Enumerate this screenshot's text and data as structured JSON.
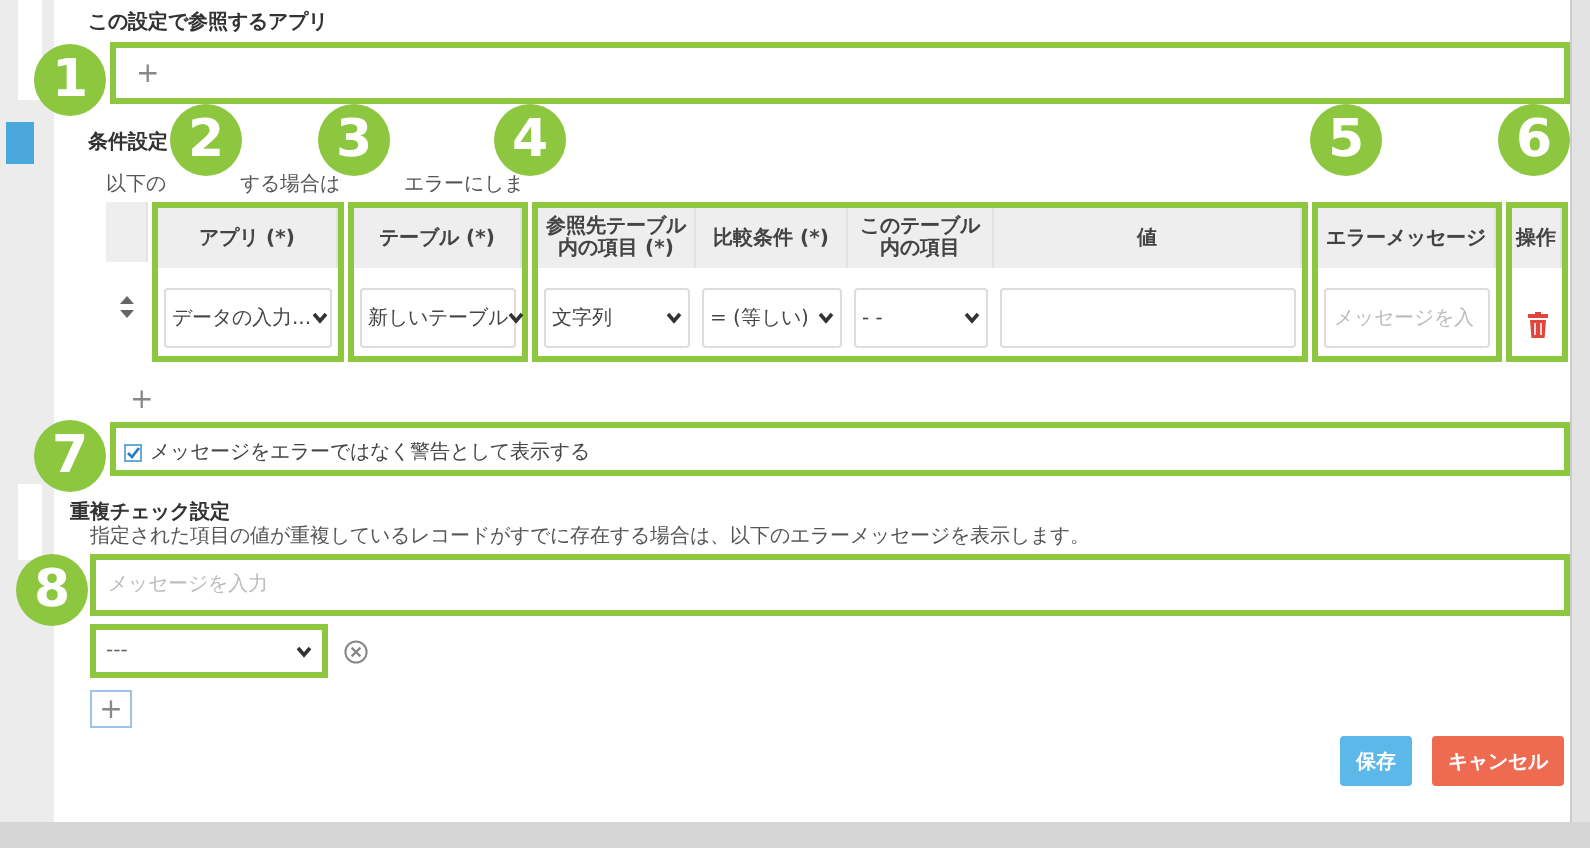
{
  "reference_apps": {
    "title": "この設定で参照するアプリ",
    "add": "+"
  },
  "conditions": {
    "title": "条件設定",
    "note_fragments": [
      "以下の",
      "する場合は",
      "エラーにしま"
    ],
    "columns": [
      {
        "label": "アプリ (*)"
      },
      {
        "label": "テーブル (*)"
      },
      {
        "label": "参照先テーブル内の項目 (*)"
      },
      {
        "label": "比較条件 (*)"
      },
      {
        "label": "このテーブル内の項目"
      },
      {
        "label": "値"
      },
      {
        "label": "エラーメッセージ"
      },
      {
        "label": "操作"
      }
    ],
    "rows": [
      {
        "cells": [
          {
            "kind": "select",
            "value": "データの入力..."
          },
          {
            "kind": "select",
            "value": "新しいテーブル"
          },
          {
            "kind": "select",
            "value": "文字列"
          },
          {
            "kind": "select",
            "value": "= (等しい)"
          },
          {
            "kind": "select",
            "value": "- -"
          },
          {
            "kind": "input"
          },
          {
            "kind": "input",
            "placeholder": "メッセージを入"
          },
          {
            "kind": "delete"
          }
        ]
      }
    ],
    "add": "+"
  },
  "warning_option": {
    "label": "メッセージをエラーではなく警告として表示する",
    "checked": true
  },
  "duplicate_check": {
    "title": "重複チェック設定",
    "note": "指定された項目の値が重複しているレコードがすでに存在する場合は、以下のエラーメッセージを表示します。",
    "message": {
      "placeholder": "メッセージを入力"
    },
    "fields": [
      {
        "value": "---"
      }
    ],
    "add": "+"
  },
  "buttons": [
    {
      "label": "保存",
      "kind": "primary"
    },
    {
      "label": "キャンセル",
      "kind": "danger"
    }
  ],
  "annotations": [
    {
      "number": "1"
    },
    {
      "number": "2"
    },
    {
      "number": "3"
    },
    {
      "number": "4"
    },
    {
      "number": "5"
    },
    {
      "number": "6"
    },
    {
      "number": "7"
    },
    {
      "number": "8"
    }
  ]
}
